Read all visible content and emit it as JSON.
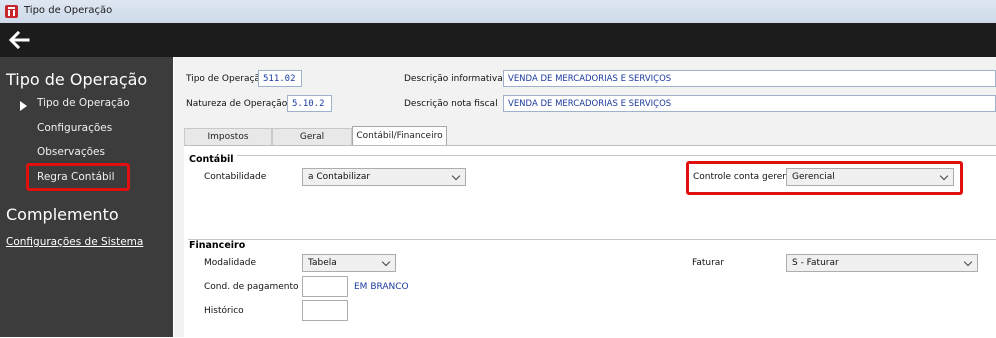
{
  "window": {
    "title": "Tipo de Operação",
    "icon": "app-logo-icon"
  },
  "navbar": {
    "back_icon": "arrow-left-icon"
  },
  "sidebar": {
    "heading": "Tipo de Operação",
    "items": [
      {
        "label": "Tipo de Operação",
        "current": true
      },
      {
        "label": "Configurações"
      },
      {
        "label": "Observações"
      },
      {
        "label": "Regra Contábil",
        "highlighted": true
      }
    ],
    "complement_heading": "Complemento",
    "system_link": "Configurações de Sistema"
  },
  "header": {
    "tipo_label": "Tipo de Operação",
    "tipo_value": "511.02",
    "natureza_label": "Natureza de Operação",
    "natureza_value": "5.10.2",
    "desc_info_label": "Descrição informativa",
    "desc_info_value": "VENDA DE MERCADORIAS E SERVIÇOS",
    "desc_nota_label": "Descrição nota fiscal",
    "desc_nota_value": "VENDA DE MERCADORIAS E SERVIÇOS"
  },
  "tabs": [
    {
      "label": "Impostos"
    },
    {
      "label": "Geral"
    },
    {
      "label": "Contábil/Financeiro",
      "active": true
    }
  ],
  "contabil": {
    "title": "Contábil",
    "contabilidade_label": "Contabilidade",
    "contabilidade_value": "a Contabilizar",
    "controle_label": "Controle conta geren.",
    "controle_value": "Gerencial"
  },
  "financeiro": {
    "title": "Financeiro",
    "modalidade_label": "Modalidade",
    "modalidade_value": "Tabela",
    "faturar_label": "Faturar",
    "faturar_value": "S - Faturar",
    "cond_label": "Cond. de pagamento",
    "cond_value": "EM BRANCO",
    "historico_label": "Histórico"
  },
  "colors": {
    "highlight": "#e01010",
    "sidebar_bg": "#3c3c3c",
    "navbar_bg": "#1c1c1c",
    "value_text": "#1c3a9e"
  }
}
